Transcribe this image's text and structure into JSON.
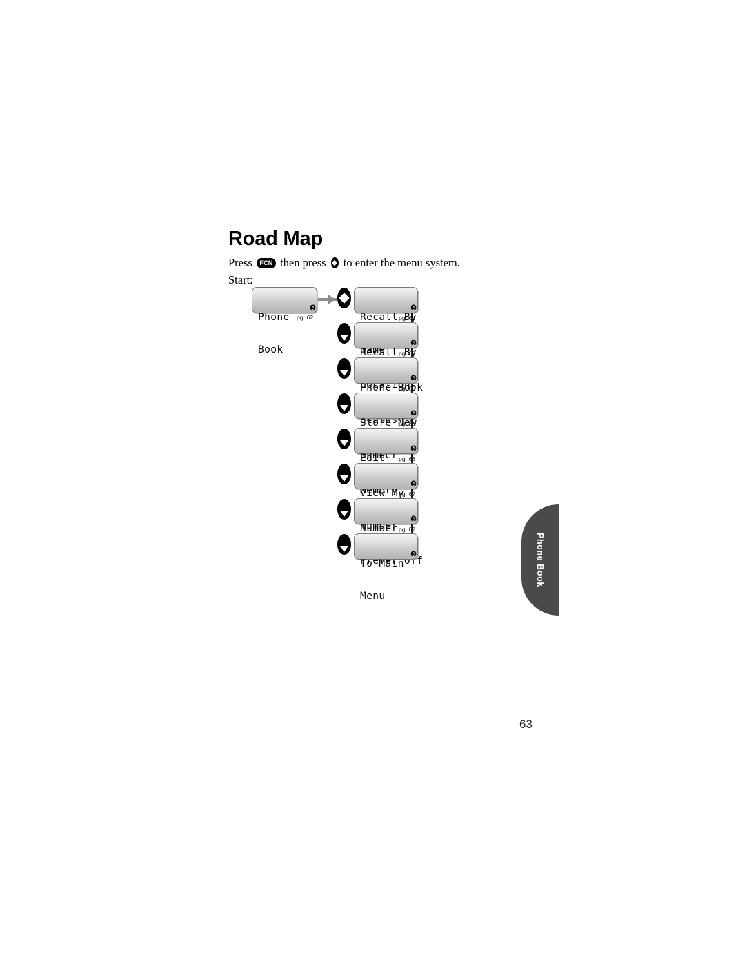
{
  "page": {
    "title": "Road Map",
    "folio": "63",
    "start_label": "Start:"
  },
  "intro": {
    "press_word": "Press",
    "fcn_key_label": "FCN",
    "then_press_words": "then press",
    "nav_key_name": "nav-diamond-key",
    "tail_words": "to enter the menu system."
  },
  "side_tab": {
    "label": "Phone Book"
  },
  "start_node": {
    "line1": "Phone",
    "line2": "Book",
    "end_glyph": "ɷ",
    "page_ref": "pg. 62"
  },
  "menu_items": [
    {
      "line1": "Recall By",
      "line2": "Name",
      "end_glyph": "ɷ",
      "page_ref": "pg. 64",
      "key_icon": "nav-diamond-key"
    },
    {
      "line1": "Recall By",
      "line2": "Location",
      "end_glyph": "ɷ",
      "page_ref": "pg. 65",
      "key_icon": "nav-down-key"
    },
    {
      "line1": "Phone Book",
      "line2": "Status",
      "end_glyph": "ɷ",
      "page_ref": "pg. 65",
      "key_icon": "nav-down-key"
    },
    {
      "line1": "Store New",
      "line2": "Number",
      "end_glyph": "ɷ",
      "page_ref": "pg. 66",
      "key_icon": "nav-down-key"
    },
    {
      "line1": "Edit",
      "line2": "Memory",
      "end_glyph": "ɷ",
      "page_ref": "pg. 68",
      "key_icon": "nav-down-key"
    },
    {
      "line1": "View My",
      "line2": "Number",
      "end_glyph": "ɷ",
      "page_ref": "pg. 67",
      "key_icon": "nav-down-key"
    },
    {
      "line1": "Number",
      "line2": "Prefer Off",
      "end_glyph": "ɷ",
      "page_ref": "pg. 67",
      "key_icon": "nav-down-key"
    },
    {
      "line1": "To Main",
      "line2": "Menu",
      "end_glyph": "ɷ",
      "page_ref": "",
      "key_icon": "nav-down-key"
    }
  ],
  "colors": {
    "tab_bg": "#4a4a4d",
    "arrow": "#8c8c8c",
    "line": "#1a1a1a",
    "lcd_light": "#f4f4f4",
    "lcd_dark": "#b4b4b4"
  }
}
